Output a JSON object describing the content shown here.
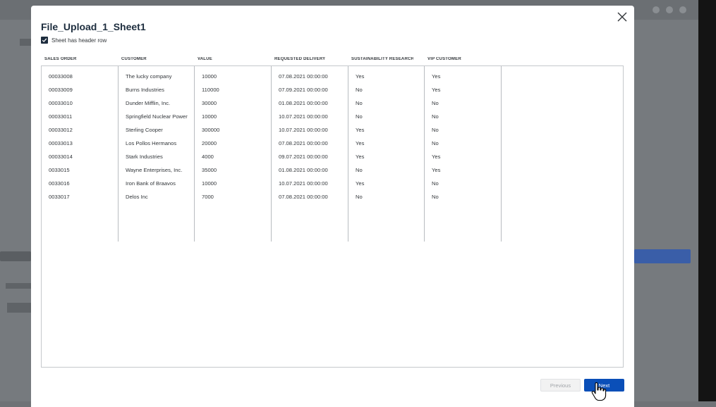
{
  "modal": {
    "title": "File_Upload_1_Sheet1",
    "header_row_checkbox": {
      "label": "Sheet has header row",
      "checked": true
    },
    "close_icon": "close-icon"
  },
  "table": {
    "columns": [
      "SALES ORDER",
      "CUSTOMER",
      "VALUE",
      "REQUESTED DELIVERY",
      "SUSTAINABILITY RESEARCH",
      "VIP CUSTOMER"
    ],
    "rows": [
      [
        "00033008",
        "The lucky company",
        "10000",
        "07.08.2021 00:00:00",
        "Yes",
        "Yes"
      ],
      [
        "00033009",
        "Burns Industries",
        "110000",
        "07.09.2021 00:00:00",
        "No",
        "Yes"
      ],
      [
        "00033010",
        "Dunder Mifflin, Inc.",
        "30000",
        "01.08.2021 00:00:00",
        "No",
        "No"
      ],
      [
        "00033011",
        "Springfield Nuclear Power",
        "10000",
        "10.07.2021 00:00:00",
        "No",
        "No"
      ],
      [
        "00033012",
        "Sterling Cooper",
        "300000",
        "10.07.2021 00:00:00",
        "Yes",
        "No"
      ],
      [
        "00033013",
        "Los Pollos Hermanos",
        "20000",
        "07.08.2021 00:00:00",
        "Yes",
        "No"
      ],
      [
        "00033014",
        "Stark Industries",
        "4000",
        "09.07.2021 00:00:00",
        "Yes",
        "Yes"
      ],
      [
        "0033015",
        "Wayne Enterprises, Inc.",
        "35000",
        "01.08.2021 00:00:00",
        "No",
        "Yes"
      ],
      [
        "0033016",
        "Iron Bank of Braavos",
        "10000",
        "10.07.2021 00:00:00",
        "Yes",
        "No"
      ],
      [
        "0033017",
        "Delos Inc",
        "7000",
        "07.08.2021 00:00:00",
        "No",
        "No"
      ]
    ]
  },
  "footer": {
    "previous_label": "Previous",
    "next_label": "Next",
    "previous_disabled": true
  },
  "colors": {
    "title": "#1d2d3e",
    "primary_button": "#0a4fb8",
    "overlay": "#767a7e"
  }
}
